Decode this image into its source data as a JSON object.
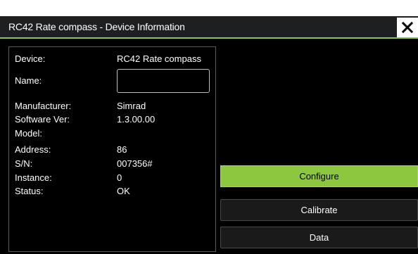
{
  "dialog": {
    "title": "RC42 Rate compass - Device Information",
    "close_icon": "close-icon"
  },
  "info": {
    "device": {
      "label": "Device:",
      "value": "RC42 Rate compass"
    },
    "name": {
      "label": "Name:",
      "value": ""
    },
    "manufacturer": {
      "label": "Manufacturer:",
      "value": "Simrad"
    },
    "software_ver": {
      "label": "Software Ver:",
      "value": "1.3.00.00"
    },
    "model": {
      "label": "Model:",
      "value": ""
    },
    "address": {
      "label": "Address:",
      "value": "86"
    },
    "serial": {
      "label": "S/N:",
      "value": "007356#"
    },
    "instance": {
      "label": "Instance:",
      "value": "0"
    },
    "status": {
      "label": "Status:",
      "value": "OK"
    }
  },
  "actions": {
    "configure_label": "Configure",
    "calibrate_label": "Calibrate",
    "data_label": "Data"
  },
  "colors": {
    "accent": "#8dc63f",
    "background": "#000000",
    "titlebar": "#1e1f20"
  }
}
